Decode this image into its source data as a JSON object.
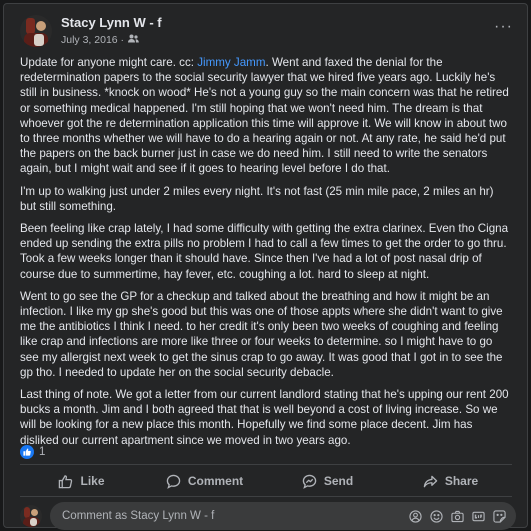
{
  "post": {
    "author": "Stacy Lynn W - f",
    "date": "July 3, 2016 ·",
    "paragraphs": [
      {
        "before": "Update for anyone might care. cc: ",
        "mention": "Jimmy Jamm",
        "after": ". Went and faxed the denial for the redetermination papers to the social security lawyer that we hired five years ago.  Luckily he's still in business. *knock on wood*  He's not a young guy so the main concern was that he retired or something medical happened.  I'm still hoping that we won't need him.  The dream is that whoever got the re determination application this time will approve it.  We will know in about two to three months whether we will have to do a hearing again or not.  At any rate, he said he'd put the papers on the back burner just in case we do need him.  I still need to write the senators again, but I might wait and see if it goes to hearing level before I do that."
      },
      {
        "text": "I'm up to walking just under 2 miles every night.  It's not fast (25 min mile pace, 2 miles an hr) but still something."
      },
      {
        "text": "Been feeling like crap lately, I had some difficulty with getting the extra clarinex.  Even tho Cigna ended up sending the extra pills no problem I had to call a few times to get the order to go thru. Took a few weeks longer than it should have. Since then I've had a lot of post nasal drip of course due to summertime, hay fever, etc.  coughing a lot. hard to sleep at night."
      },
      {
        "text": "Went to go see the GP for a checkup and talked about the breathing and how it might be an infection.  I like my gp  she's good but this was one of those appts where she didn't want to give me the antibiotics I think I need.  to her credit it's only been two weeks of coughing and feeling like crap and infections are more like three or four weeks to determine.  so I might have to go see my allergist next week to get the sinus crap to go away.  It was good that I got in to see the gp tho.  I needed to update her on the social security debacle."
      },
      {
        "text": "Last thing of note. We got a letter from our current landlord stating that he's upping our rent 200 bucks a month.  Jim and I both agreed that that is well beyond a cost of living increase.  So we will be looking for a new place this month.  Hopefully we find some place decent. Jim has disliked our current apartment since we moved in two years ago."
      }
    ],
    "reaction_count": "1"
  },
  "actions": {
    "like": "Like",
    "comment": "Comment",
    "send": "Send",
    "share": "Share"
  },
  "comment_box": {
    "placeholder": "Comment as Stacy Lynn W - f"
  },
  "icons": [
    "more-icon",
    "audience-friends-icon",
    "like-reaction-icon",
    "like-icon",
    "comment-icon",
    "send-icon",
    "share-icon",
    "avatar-icon",
    "emoji-icon",
    "camera-icon",
    "gif-icon",
    "sticker-icon"
  ],
  "colors": {
    "accent": "#1877f2",
    "mention": "#4599ff",
    "background": "#242526"
  }
}
